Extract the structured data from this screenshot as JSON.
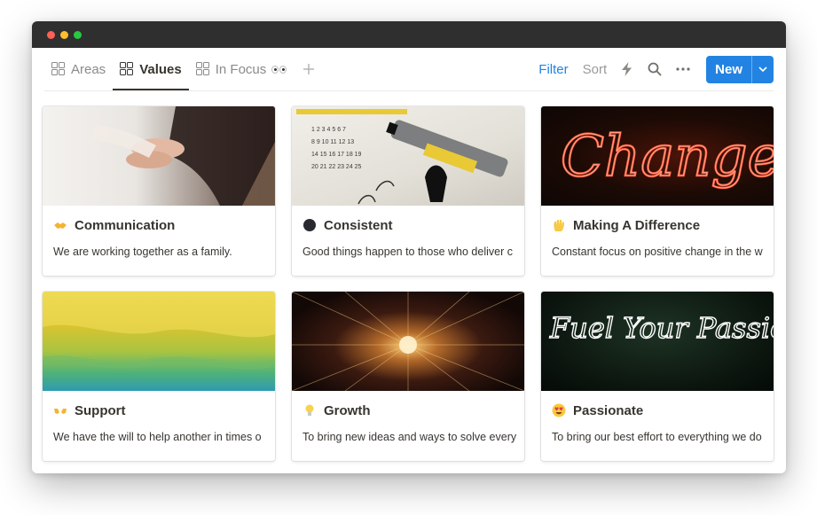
{
  "toolbar": {
    "tabs": [
      {
        "label": "Areas",
        "icon": "grid-icon",
        "active": false
      },
      {
        "label": "Values",
        "icon": "grid-icon",
        "active": true
      },
      {
        "label": "In Focus",
        "icon": "grid-icon",
        "active": false,
        "suffix_emoji": "eyes"
      }
    ],
    "add_tab_icon": "plus-icon",
    "filter_label": "Filter",
    "sort_label": "Sort",
    "automation_icon": "lightning-icon",
    "search_icon": "search-icon",
    "more_icon": "ellipsis-icon",
    "new_label": "New",
    "new_dropdown_icon": "chevron-down-icon"
  },
  "colors": {
    "accent": "#2383e2",
    "titlebar": "#2f2f30",
    "text": "#37352f"
  },
  "cards": [
    {
      "title": "Communication",
      "emoji": "handshake",
      "description": "We are working together as a family.",
      "cover": "hands"
    },
    {
      "title": "Consistent",
      "emoji": "black-circle",
      "description": "Good things happen to those who deliver c",
      "cover": "calendar"
    },
    {
      "title": "Making A Difference",
      "emoji": "raised-hand",
      "description": "Constant focus on positive change in the w",
      "cover": "neon-change"
    },
    {
      "title": "Support",
      "emoji": "open-hands",
      "description": "We have the will to help another in times o",
      "cover": "watercolor"
    },
    {
      "title": "Growth",
      "emoji": "light-bulb",
      "description": "To bring new ideas and ways to solve every",
      "cover": "light-tunnel"
    },
    {
      "title": "Passionate",
      "emoji": "heart-eyes",
      "description": "To bring our best effort to everything we do",
      "cover": "neon-passion"
    }
  ],
  "covers": {
    "neon_change_text": "Change",
    "neon_passion_text": "Fuel Your Passion"
  }
}
